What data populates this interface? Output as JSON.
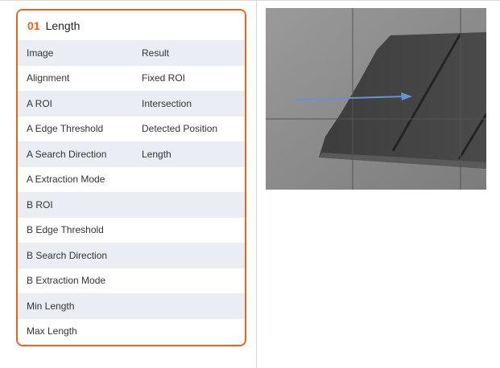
{
  "panel": {
    "number": "01",
    "title": "Length",
    "rows": [
      {
        "left": "Image",
        "right": "Result"
      },
      {
        "left": "Alignment",
        "right": "Fixed ROI"
      },
      {
        "left": "A ROI",
        "right": "Intersection"
      },
      {
        "left": "A Edge Threshold",
        "right": "Detected Position"
      },
      {
        "left": "A Search Direction",
        "right": "Length"
      },
      {
        "left": "A Extraction Mode",
        "right": ""
      },
      {
        "left": "B ROI",
        "right": ""
      },
      {
        "left": "B Edge Threshold",
        "right": ""
      },
      {
        "left": "B Search Direction",
        "right": ""
      },
      {
        "left": "B Extraction Mode",
        "right": ""
      },
      {
        "left": "Min Length",
        "right": ""
      },
      {
        "left": "Max Length",
        "right": ""
      }
    ]
  },
  "colors": {
    "accent": "#e8641c",
    "row_shade": "#eaedf4",
    "arrow": "#6a8fd8"
  },
  "image": {
    "subject": "grayscale photo of cutter blade segments with grid lines and a blue direction arrow"
  }
}
